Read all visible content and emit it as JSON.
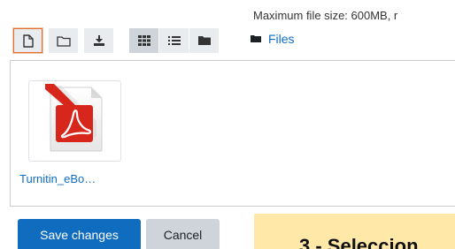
{
  "header": {
    "max_file_size": "Maximum file size: 600MB, r"
  },
  "toolbar": {
    "buttons": [
      {
        "name": "add-file-icon",
        "color": "#333333"
      },
      {
        "name": "create-folder-icon",
        "color": "#333333"
      },
      {
        "name": "download-icon",
        "color": "#333333"
      },
      {
        "name": "grid-view-icon",
        "color": "#333333"
      },
      {
        "name": "list-view-icon",
        "color": "#333333"
      },
      {
        "name": "tree-view-icon",
        "color": "#333333"
      }
    ]
  },
  "path": {
    "label": "Files"
  },
  "files": [
    {
      "name": "Turnitin_eBo…",
      "icon": "pdf-file-icon"
    }
  ],
  "actions": {
    "save_label": "Save changes",
    "cancel_label": "Cancel"
  },
  "callout": {
    "text": "3 - Seleccion"
  },
  "colors": {
    "accent": "#0f6cbf",
    "focus": "#e06c2d",
    "callout_bg": "#ffe8a8",
    "pdf_red": "#d7261c"
  }
}
